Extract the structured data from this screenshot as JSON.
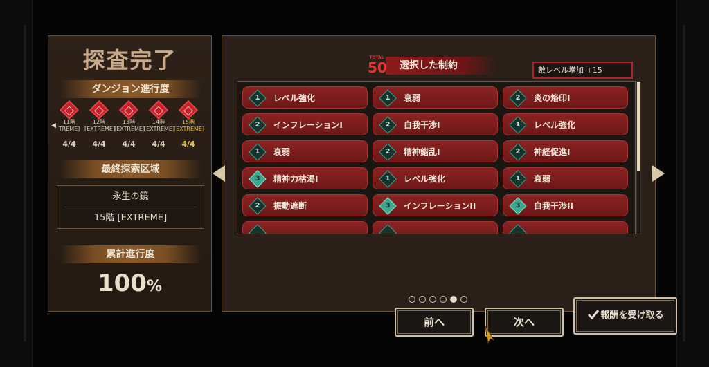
{
  "left": {
    "title": "探査完了",
    "progress_heading": "ダンジョン進行度",
    "floors": [
      {
        "num": "11階",
        "diff": "TREME]",
        "score": "4/4",
        "current": false
      },
      {
        "num": "12階",
        "diff": "[EXTREME]",
        "score": "4/4",
        "current": false
      },
      {
        "num": "13階",
        "diff": "[EXTREME]",
        "score": "4/4",
        "current": false
      },
      {
        "num": "14階",
        "diff": "[EXTREME]",
        "score": "4/4",
        "current": false
      },
      {
        "num": "15階",
        "diff": "[EXTREME]",
        "score": "4/4",
        "current": true
      }
    ],
    "area_heading": "最終探索区域",
    "area_name": "永生の鏡",
    "area_floor": "15階 [EXTREME]",
    "total_heading": "累計進行度",
    "total_value": "100",
    "total_unit": "%"
  },
  "right": {
    "total_label": "TOTAL",
    "total_value": "50",
    "title": "選択した制約",
    "enemy_level": "敵レベル増加 +15",
    "constraints": [
      {
        "level": "1",
        "label": "レベル強化"
      },
      {
        "level": "1",
        "label": "衰弱"
      },
      {
        "level": "2",
        "label": "炎の烙印I"
      },
      {
        "level": "2",
        "label": "インフレーションI"
      },
      {
        "level": "2",
        "label": "自我干渉I"
      },
      {
        "level": "1",
        "label": "レベル強化"
      },
      {
        "level": "1",
        "label": "衰弱"
      },
      {
        "level": "2",
        "label": "精神錯乱I"
      },
      {
        "level": "2",
        "label": "神経促進I"
      },
      {
        "level": "3",
        "label": "精神力枯渇I"
      },
      {
        "level": "1",
        "label": "レベル強化"
      },
      {
        "level": "1",
        "label": "衰弱"
      },
      {
        "level": "2",
        "label": "振動遮断"
      },
      {
        "level": "3",
        "label": "インフレーションII"
      },
      {
        "level": "3",
        "label": "自我干渉II"
      }
    ]
  },
  "pagination": {
    "count": 6,
    "active": 4
  },
  "buttons": {
    "prev": "前へ",
    "next": "次へ",
    "claim": "報酬を受け取る"
  },
  "colors": {
    "accent_red": "#8a2222",
    "level_teal": "#3aa88e",
    "current_floor": "#e8c23a"
  }
}
